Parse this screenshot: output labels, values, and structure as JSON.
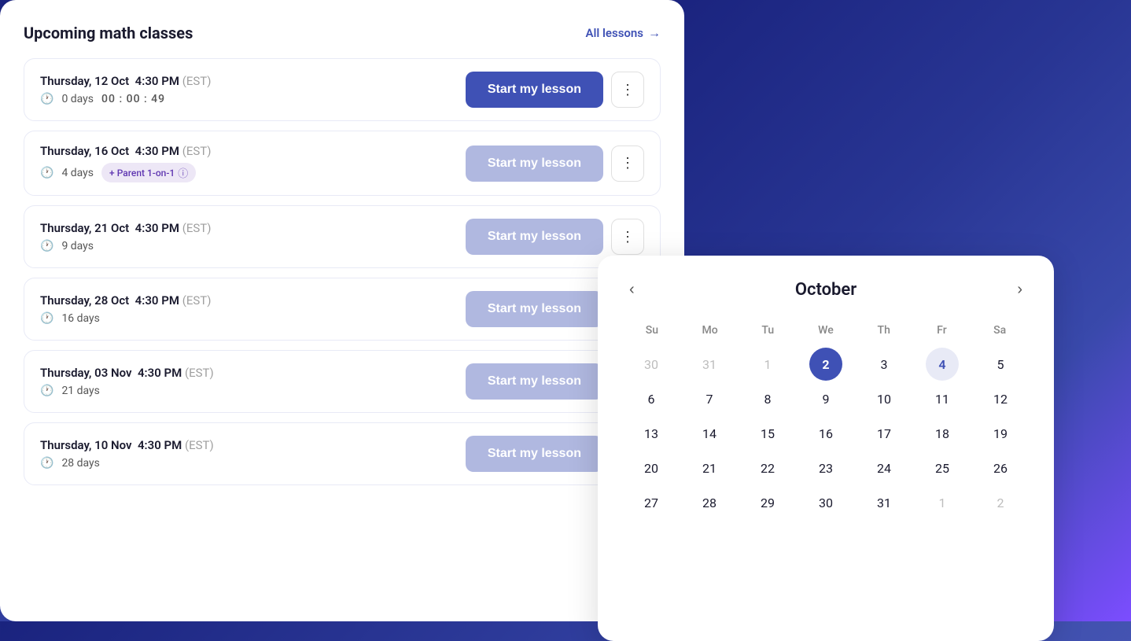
{
  "header": {
    "title": "Upcoming math classes",
    "all_lessons_label": "All lessons",
    "arrow": "→"
  },
  "lessons": [
    {
      "date": "Thursday, 12 Oct",
      "time": "4:30 PM",
      "est": "(EST)",
      "days": "0 days",
      "timer": "00 : 00 : 49",
      "active": true,
      "badge": null,
      "btn_label": "Start my lesson"
    },
    {
      "date": "Thursday, 16 Oct",
      "time": "4:30 PM",
      "est": "(EST)",
      "days": "4 days",
      "timer": null,
      "active": false,
      "badge": "+ Parent 1-on-1",
      "btn_label": "Start my lesson"
    },
    {
      "date": "Thursday, 21 Oct",
      "time": "4:30 PM",
      "est": "(EST)",
      "days": "9 days",
      "timer": null,
      "active": false,
      "badge": null,
      "btn_label": "Start my lesson"
    },
    {
      "date": "Thursday, 28 Oct",
      "time": "4:30 PM",
      "est": "(EST)",
      "days": "16 days",
      "timer": null,
      "active": false,
      "badge": null,
      "btn_label": "Start my lesson"
    },
    {
      "date": "Thursday, 03 Nov",
      "time": "4:30 PM",
      "est": "(EST)",
      "days": "21 days",
      "timer": null,
      "active": false,
      "badge": null,
      "btn_label": "Start my lesson"
    },
    {
      "date": "Thursday, 10 Nov",
      "time": "4:30 PM",
      "est": "(EST)",
      "days": "28 days",
      "timer": null,
      "active": false,
      "badge": null,
      "btn_label": "Start my lesson"
    }
  ],
  "calendar": {
    "month": "October",
    "prev_label": "‹",
    "next_label": "›",
    "weekdays": [
      "Su",
      "Mo",
      "Tu",
      "We",
      "Th",
      "Fr",
      "Sa"
    ],
    "today": 2,
    "selected": 4,
    "rows": [
      [
        {
          "day": "30",
          "muted": true
        },
        {
          "day": "31",
          "muted": true
        },
        {
          "day": "1",
          "muted": true
        },
        {
          "day": "2",
          "today": true
        },
        {
          "day": "3"
        },
        {
          "day": "4",
          "selected": true
        },
        {
          "day": "5"
        }
      ],
      [
        {
          "day": "6"
        },
        {
          "day": "7"
        },
        {
          "day": "8"
        },
        {
          "day": "9"
        },
        {
          "day": "10"
        },
        {
          "day": "11"
        },
        {
          "day": "12"
        }
      ],
      [
        {
          "day": "13"
        },
        {
          "day": "14"
        },
        {
          "day": "15"
        },
        {
          "day": "16"
        },
        {
          "day": "17"
        },
        {
          "day": "18"
        },
        {
          "day": "19"
        }
      ],
      [
        {
          "day": "20"
        },
        {
          "day": "21"
        },
        {
          "day": "22"
        },
        {
          "day": "23"
        },
        {
          "day": "24"
        },
        {
          "day": "25"
        },
        {
          "day": "26"
        }
      ],
      [
        {
          "day": "27"
        },
        {
          "day": "28"
        },
        {
          "day": "29"
        },
        {
          "day": "30"
        },
        {
          "day": "31"
        },
        {
          "day": "1",
          "muted": true
        },
        {
          "day": "2",
          "muted": true
        }
      ]
    ]
  }
}
